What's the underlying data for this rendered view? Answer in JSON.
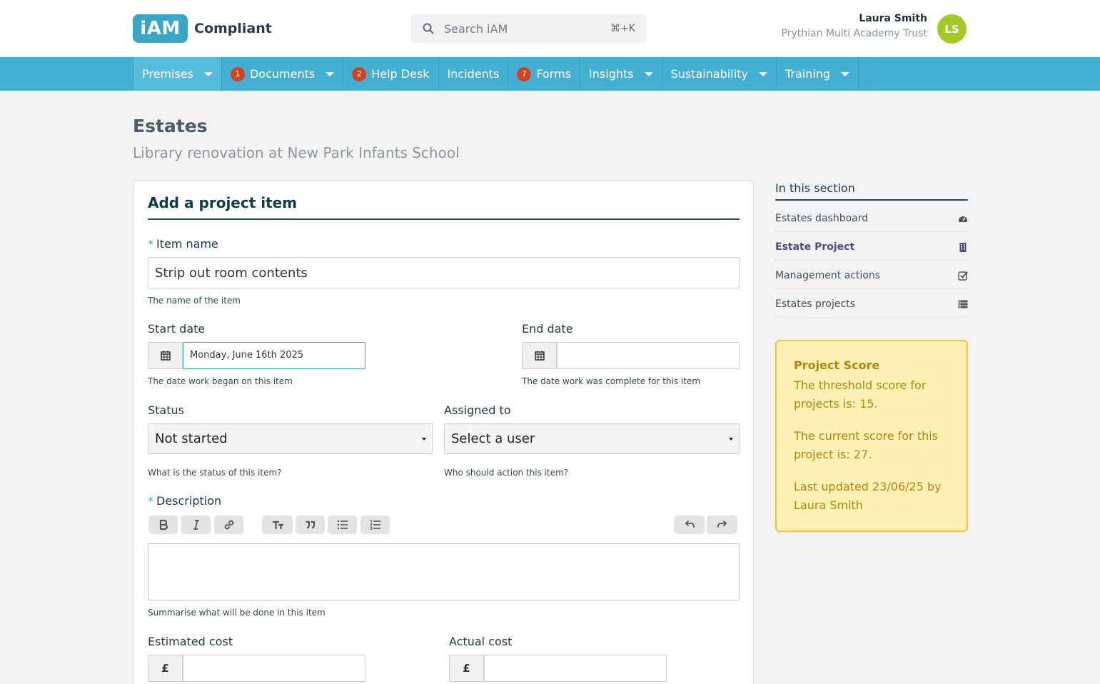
{
  "header": {
    "logo_mark": "iAM",
    "logo_text": "Compliant",
    "search_placeholder": "Search iAM",
    "search_shortcut": "⌘+K",
    "user_name": "Laura Smith",
    "user_org": "Prythian Multi Academy Trust",
    "avatar_initials": "LS"
  },
  "nav": {
    "items": [
      {
        "label": "Premises",
        "badge": "",
        "dropdown": true
      },
      {
        "label": "Documents",
        "badge": "1",
        "dropdown": true
      },
      {
        "label": "Help Desk",
        "badge": "2",
        "dropdown": false
      },
      {
        "label": "Incidents",
        "badge": "",
        "dropdown": false
      },
      {
        "label": "Forms",
        "badge": "7",
        "dropdown": false
      },
      {
        "label": "Insights",
        "badge": "",
        "dropdown": true
      },
      {
        "label": "Sustainability",
        "badge": "",
        "dropdown": true
      },
      {
        "label": "Training",
        "badge": "",
        "dropdown": true
      }
    ]
  },
  "page": {
    "title": "Estates",
    "subtitle": "Library renovation at New Park Infants School"
  },
  "form": {
    "title": "Add a project item",
    "item_name": {
      "required": "*",
      "label": "Item name",
      "value": "Strip out room contents",
      "help": "The name of the item"
    },
    "start_date": {
      "label": "Start date",
      "value": "Monday, June 16th 2025",
      "help": "The date work began on this item"
    },
    "end_date": {
      "label": "End date",
      "value": "",
      "help": "The date work was complete for this item"
    },
    "status": {
      "label": "Status",
      "value": "Not started",
      "help": "What is the status of this item?"
    },
    "assigned_to": {
      "label": "Assigned to",
      "value": "Select a user",
      "help": "Who should action this item?"
    },
    "description": {
      "required": "*",
      "label": "Description",
      "value": "",
      "help": "Summarise what will be done in this item"
    },
    "estimated_cost": {
      "label": "Estimated cost",
      "currency": "£",
      "value": ""
    },
    "actual_cost": {
      "label": "Actual cost",
      "currency": "£",
      "value": ""
    }
  },
  "sidebar": {
    "title": "In this section",
    "items": [
      {
        "label": "Estates dashboard",
        "icon": "dashboard-icon"
      },
      {
        "label": "Estate Project",
        "icon": "building-icon",
        "active": true
      },
      {
        "label": "Management actions",
        "icon": "checkbox-icon"
      },
      {
        "label": "Estates projects",
        "icon": "list-icon"
      }
    ]
  },
  "score_panel": {
    "title": "Project Score",
    "threshold": "The threshold score for projects is: 15.",
    "current": "The current score for this project is: 27.",
    "updated": "Last updated 23/06/25 by Laura Smith"
  },
  "colors": {
    "brand": "#3aa6c4",
    "nav_bg": "#43b0d3",
    "badge": "#d2421f",
    "avatar": "#a3c928",
    "score_bg": "#fff1b3",
    "score_border": "#f0c33a"
  }
}
